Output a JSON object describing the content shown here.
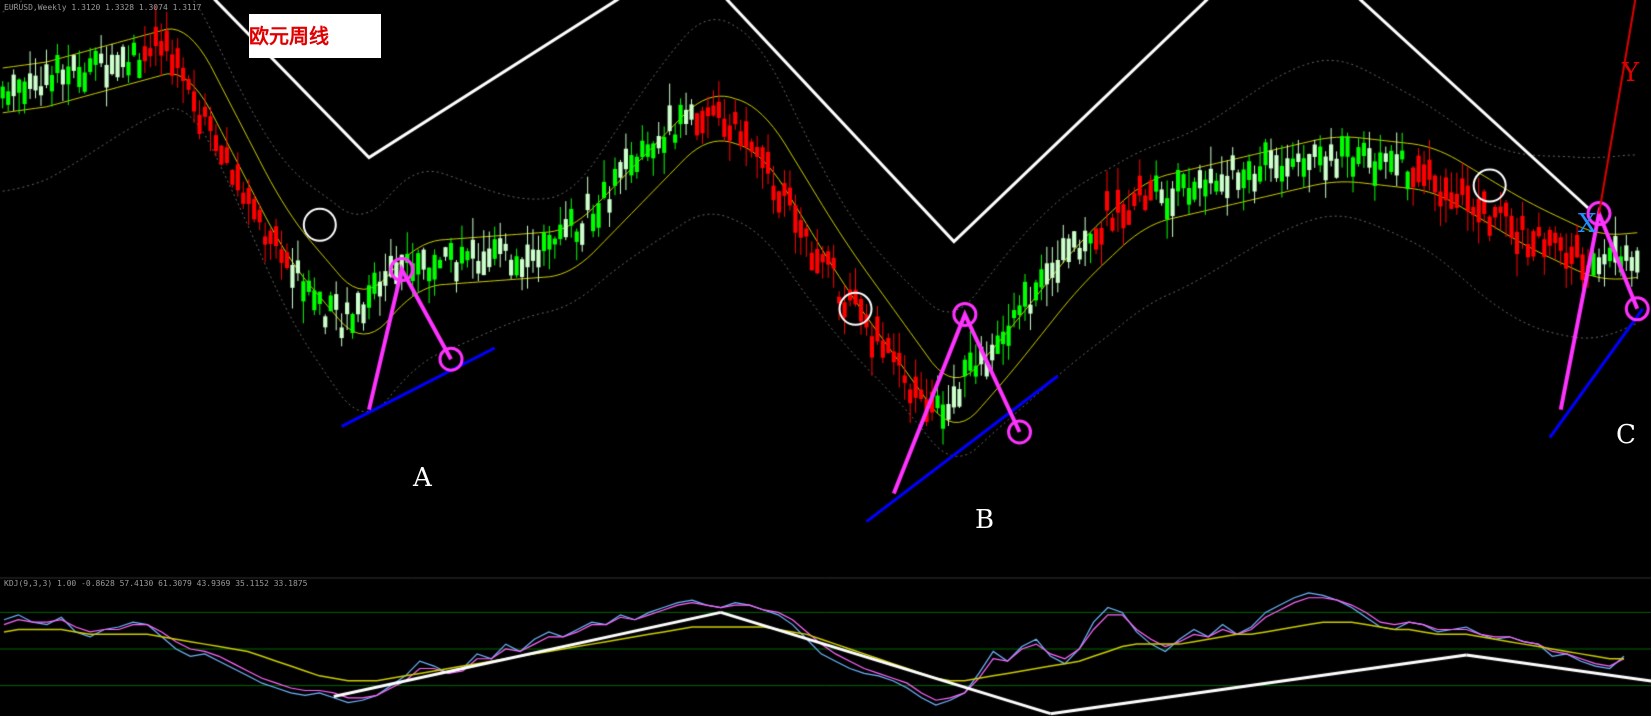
{
  "title": "欧元周线",
  "header": {
    "main_info": "EURUSD,Weekly  1.3120 1.3328 1.3074 1.3117",
    "oscillator_info": "KDJ(9,3,3) 1.00 -0.8628 57.4130 61.3079 43.9369 35.1152 33.1875"
  },
  "pattern_labels": {
    "a": "A",
    "b": "B",
    "c": "C",
    "x": "X",
    "y": "Y"
  },
  "colors": {
    "background": "#000000",
    "bull_candle": "#00ff00",
    "bull_candle_light": "#ccffcc",
    "bear_candle": "#ff0000",
    "trend_line": "#ffffff",
    "pattern_line": "#ff33ff",
    "support_line": "#0000ff",
    "projection_line": "#e00000",
    "moving_average": "#cccc00",
    "envelope": "#666666",
    "osc_k": "#6fb6ff",
    "osc_d": "#ff66ff",
    "osc_j": "#cccc00",
    "osc_level": "#006600"
  },
  "chart_data": [
    {
      "type": "candlestick",
      "title": "欧元周线",
      "xlabel": "",
      "ylabel": "",
      "ylim": [
        0,
        100
      ],
      "candle_count": 300,
      "trend": [
        [
          0,
          86
        ],
        [
          30,
          94
        ],
        [
          48,
          60
        ],
        [
          62,
          44
        ],
        [
          72,
          55
        ],
        [
          100,
          57
        ],
        [
          125,
          82
        ],
        [
          135,
          79
        ],
        [
          150,
          55
        ],
        [
          170,
          28
        ],
        [
          180,
          39
        ],
        [
          193,
          55
        ],
        [
          205,
          66
        ],
        [
          240,
          74
        ],
        [
          258,
          72
        ],
        [
          275,
          62
        ],
        [
          288,
          56
        ],
        [
          300,
          57
        ]
      ],
      "bear_ranges": [
        [
          26,
          52
        ],
        [
          127,
          170
        ],
        [
          200,
          210
        ],
        [
          258,
          290
        ]
      ],
      "pattern_points": {
        "A": {
          "zigzag": [
            [
              67,
              29
            ],
            [
              73,
              54
            ],
            [
              82,
              38
            ]
          ],
          "support": [
            [
              62,
              26
            ],
            [
              90,
              40
            ]
          ]
        },
        "B": {
          "zigzag": [
            [
              163,
              14
            ],
            [
              176,
              46
            ],
            [
              186,
              25
            ]
          ],
          "support": [
            [
              158,
              9
            ],
            [
              193,
              35
            ]
          ]
        },
        "C": {
          "zigzag": [
            [
              285,
              29
            ],
            [
              292,
              64
            ],
            [
              299,
              47
            ]
          ],
          "support": [
            [
              283,
              24
            ],
            [
              300,
              47
            ]
          ]
        }
      },
      "white_circles": [
        [
          58,
          62
        ],
        [
          156,
          47
        ],
        [
          272,
          69
        ]
      ],
      "white_zigzag": [
        [
          27,
          114
        ],
        [
          67,
          74
        ],
        [
          125,
          110
        ],
        [
          174,
          59
        ],
        [
          234,
          115
        ],
        [
          290,
          65
        ]
      ],
      "resistance_line": [
        [
          16,
          128
        ],
        [
          300,
          105
        ]
      ],
      "projection_line": [
        [
          292,
          64
        ],
        [
          300,
          110
        ]
      ],
      "grid": false,
      "legend": "none"
    },
    {
      "type": "line",
      "title": "",
      "ylim": [
        0,
        100
      ],
      "levels": [
        80,
        50,
        20
      ],
      "series": [
        {
          "values": [
            74,
            78,
            72,
            70,
            76,
            64,
            60,
            66,
            68,
            72,
            70,
            60,
            50,
            44,
            46,
            40,
            34,
            28,
            22,
            18,
            14,
            12,
            14,
            10,
            6,
            8,
            12,
            20,
            28,
            40,
            36,
            30,
            34,
            46,
            42,
            54,
            48,
            58,
            64,
            60,
            66,
            72,
            70,
            78,
            74,
            80,
            84,
            88,
            90,
            86,
            84,
            88,
            86,
            82,
            78,
            70,
            58,
            46,
            40,
            34,
            30,
            28,
            24,
            18,
            10,
            4,
            8,
            14,
            30,
            48,
            40,
            52,
            58,
            44,
            38,
            50,
            72,
            84,
            80,
            64,
            54,
            48,
            58,
            66,
            60,
            70,
            62,
            68,
            80,
            86,
            92,
            96,
            94,
            90,
            84,
            76,
            68,
            66,
            72,
            70,
            64,
            66,
            68,
            62,
            58,
            60,
            56,
            54,
            44,
            46,
            40,
            36,
            34,
            44
          ]
        },
        {
          "values": [
            70,
            74,
            72,
            72,
            74,
            68,
            64,
            66,
            66,
            70,
            70,
            64,
            56,
            50,
            48,
            44,
            38,
            32,
            26,
            22,
            18,
            16,
            16,
            14,
            10,
            10,
            12,
            18,
            24,
            34,
            34,
            30,
            32,
            42,
            42,
            50,
            48,
            54,
            60,
            60,
            64,
            70,
            70,
            76,
            74,
            78,
            82,
            86,
            88,
            86,
            84,
            86,
            86,
            82,
            80,
            74,
            64,
            54,
            46,
            40,
            34,
            30,
            26,
            22,
            14,
            8,
            10,
            14,
            26,
            42,
            40,
            50,
            54,
            46,
            42,
            50,
            66,
            78,
            78,
            66,
            58,
            52,
            56,
            62,
            60,
            66,
            62,
            66,
            76,
            82,
            88,
            92,
            92,
            90,
            86,
            80,
            72,
            70,
            72,
            70,
            66,
            66,
            66,
            62,
            60,
            60,
            56,
            54,
            48,
            46,
            42,
            38,
            36,
            42
          ]
        },
        {
          "values": [
            64,
            66,
            66,
            66,
            66,
            64,
            62,
            62,
            62,
            62,
            62,
            60,
            58,
            56,
            54,
            52,
            50,
            48,
            44,
            40,
            36,
            32,
            28,
            26,
            24,
            24,
            24,
            26,
            28,
            30,
            32,
            34,
            36,
            38,
            40,
            42,
            44,
            46,
            48,
            50,
            52,
            54,
            56,
            58,
            60,
            62,
            64,
            66,
            68,
            68,
            68,
            68,
            68,
            68,
            66,
            64,
            62,
            58,
            54,
            50,
            46,
            42,
            38,
            34,
            30,
            26,
            24,
            24,
            26,
            28,
            30,
            32,
            34,
            36,
            38,
            40,
            44,
            48,
            52,
            54,
            54,
            54,
            54,
            56,
            58,
            60,
            62,
            62,
            64,
            66,
            68,
            70,
            72,
            72,
            72,
            70,
            68,
            66,
            66,
            64,
            62,
            62,
            62,
            60,
            58,
            56,
            54,
            52,
            50,
            48,
            46,
            44,
            42,
            42
          ]
        }
      ],
      "trend_lines": [
        [
          [
            23,
            11
          ],
          [
            50,
            80
          ]
        ],
        [
          [
            50,
            80
          ],
          [
            73,
            -3
          ]
        ],
        [
          [
            73,
            -3
          ],
          [
            102,
            45
          ]
        ],
        [
          [
            102,
            45
          ],
          [
            128,
            2
          ]
        ]
      ]
    }
  ]
}
